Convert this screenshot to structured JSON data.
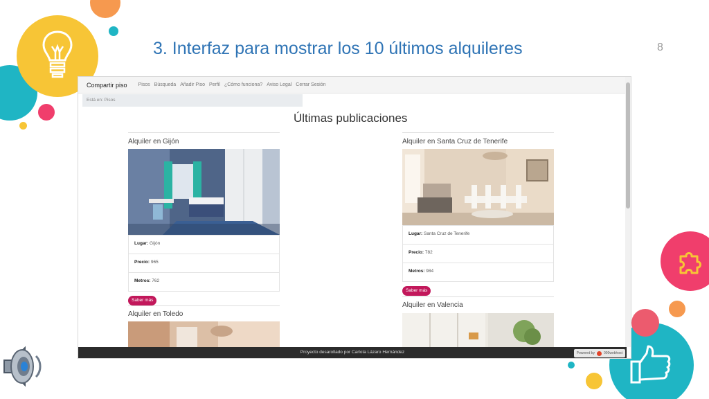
{
  "slide": {
    "title": "3. Interfaz para mostrar los 10 últimos alquileres",
    "page_number": "8"
  },
  "colors": {
    "title": "#2f74b5",
    "yellow": "#f7c536",
    "orange": "#f6994f",
    "teal": "#1fb5c4",
    "pink": "#f03e6c",
    "button": "#c2185b"
  },
  "icons": {
    "bulb": "lightbulb-icon",
    "puzzle": "puzzle-icon",
    "thumb": "thumbs-up-icon",
    "speaker": "speaker-icon"
  },
  "website": {
    "brand": "Compartir piso",
    "nav": [
      "Pisos",
      "Búsqueda",
      "Añadir Piso",
      "Perfil",
      "¿Cómo funciona?",
      "Aviso Legal",
      "Cerrar Sesión"
    ],
    "breadcrumb": "Está en: Pisos",
    "section_title": "Últimas publicaciones",
    "listings": [
      {
        "title": "Alquiler en Gijón",
        "lugar_label": "Lugar:",
        "lugar": "Gijón",
        "precio_label": "Precio:",
        "precio": "965",
        "metros_label": "Metros:",
        "metros": "762",
        "button": "Saber más"
      },
      {
        "title": "Alquiler en Santa Cruz de Tenerife",
        "lugar_label": "Lugar:",
        "lugar": "Santa Cruz de Tenerife",
        "precio_label": "Precio:",
        "precio": "782",
        "metros_label": "Metros:",
        "metros": "984",
        "button": "Saber más"
      },
      {
        "title": "Alquiler en Toledo"
      },
      {
        "title": "Alquiler en Valencia"
      }
    ],
    "footer": "Proyecto desarollado por Carlota Lázaro Hernández",
    "powered_prefix": "Powered by",
    "powered_brand": "000webhost"
  }
}
